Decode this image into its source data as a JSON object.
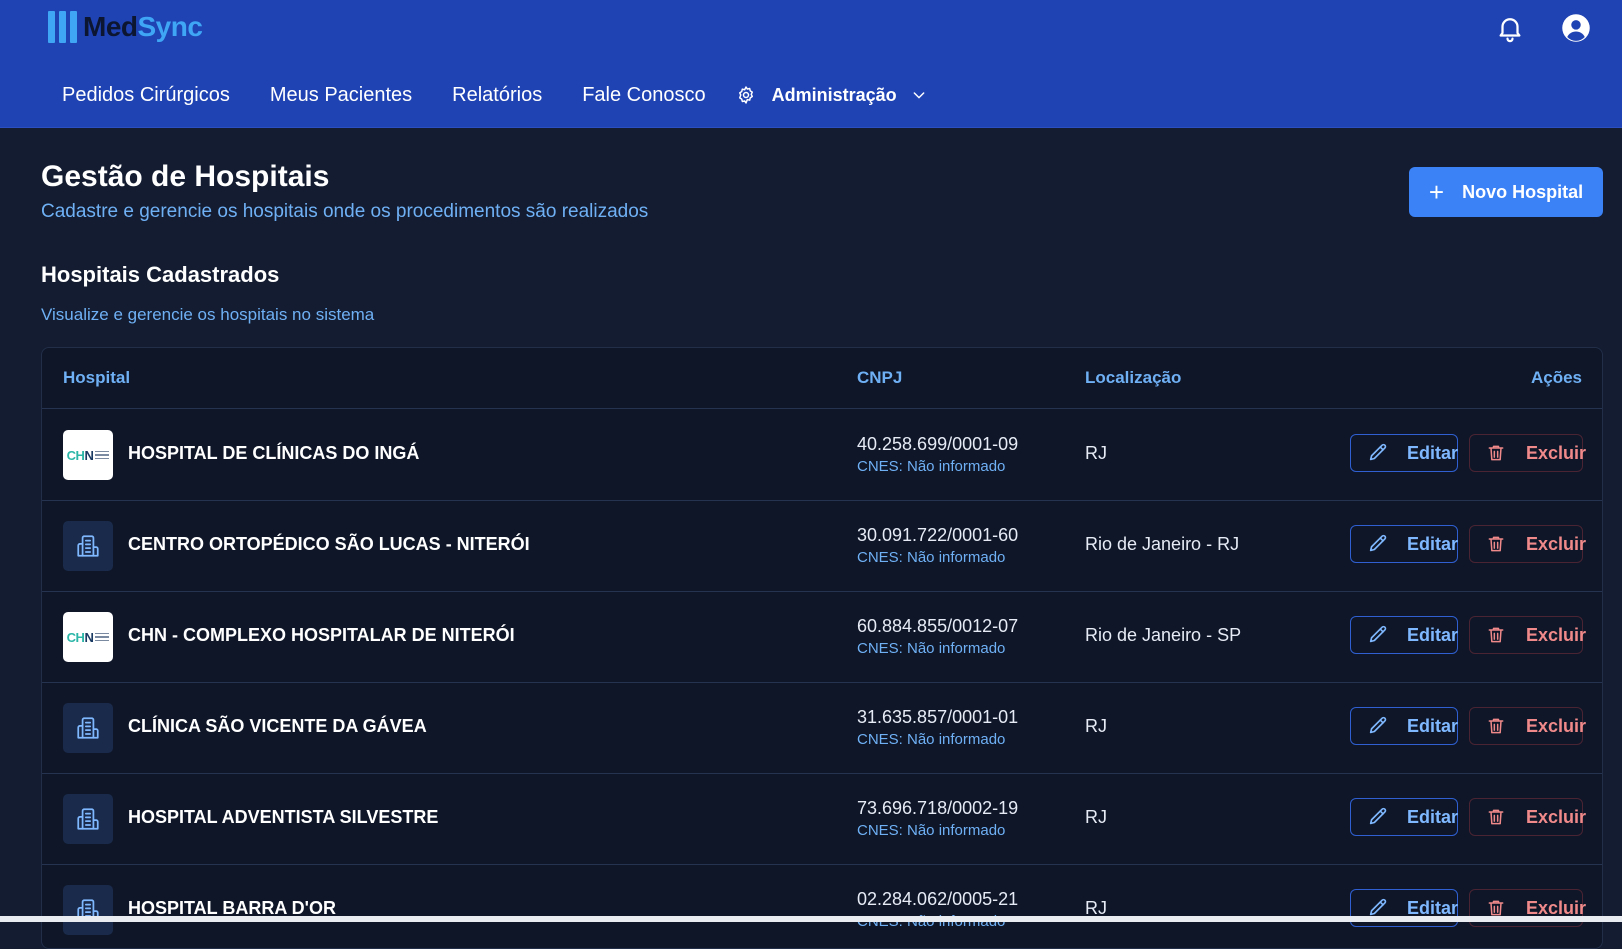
{
  "app": {
    "logo_part1": "Med",
    "logo_part2": "Sync"
  },
  "header": {
    "nav": [
      "Pedidos Cirúrgicos",
      "Meus Pacientes",
      "Relatórios",
      "Fale Conosco"
    ],
    "admin_label": "Administração",
    "icons": [
      "bell-icon",
      "user-icon",
      "gear-icon",
      "chevron-down-icon"
    ]
  },
  "page": {
    "title": "Gestão de Hospitais",
    "subtitle": "Cadastre e gerencie os hospitais onde os procedimentos são realizados",
    "new_button": "Novo Hospital"
  },
  "section": {
    "title": "Hospitais Cadastrados",
    "subtitle": "Visualize e gerencie os hospitais no sistema"
  },
  "table": {
    "columns": [
      "Hospital",
      "CNPJ",
      "Localização",
      "Ações"
    ],
    "edit_label": "Editar",
    "delete_label": "Excluir",
    "rows": [
      {
        "name": "HOSPITAL DE CLÍNICAS DO INGÁ",
        "cnpj": "40.258.699/0001-09",
        "cnes": "CNES: Não informado",
        "location": "RJ",
        "thumb": "logo"
      },
      {
        "name": "CENTRO ORTOPÉDICO SÃO LUCAS - NITERÓI",
        "cnpj": "30.091.722/0001-60",
        "cnes": "CNES: Não informado",
        "location": "Rio de Janeiro - RJ",
        "thumb": "building-icon"
      },
      {
        "name": "CHN - COMPLEXO HOSPITALAR DE NITERÓI",
        "cnpj": "60.884.855/0012-07",
        "cnes": "CNES: Não informado",
        "location": "Rio de Janeiro - SP",
        "thumb": "logo"
      },
      {
        "name": "CLÍNICA SÃO VICENTE DA GÁVEA",
        "cnpj": "31.635.857/0001-01",
        "cnes": "CNES: Não informado",
        "location": "RJ",
        "thumb": "building-icon"
      },
      {
        "name": "HOSPITAL ADVENTISTA SILVESTRE",
        "cnpj": "73.696.718/0002-19",
        "cnes": "CNES: Não informado",
        "location": "RJ",
        "thumb": "building-icon"
      },
      {
        "name": "HOSPITAL BARRA D'OR",
        "cnpj": "02.284.062/0005-21",
        "cnes": "CNES: Não informado",
        "location": "RJ",
        "thumb": "building-icon"
      }
    ]
  },
  "colors": {
    "header_bg": "#1f43b3",
    "page_bg": "#131c30",
    "accent": "#3b82f6",
    "link": "#6fb0f5",
    "danger": "#f08a8a"
  }
}
